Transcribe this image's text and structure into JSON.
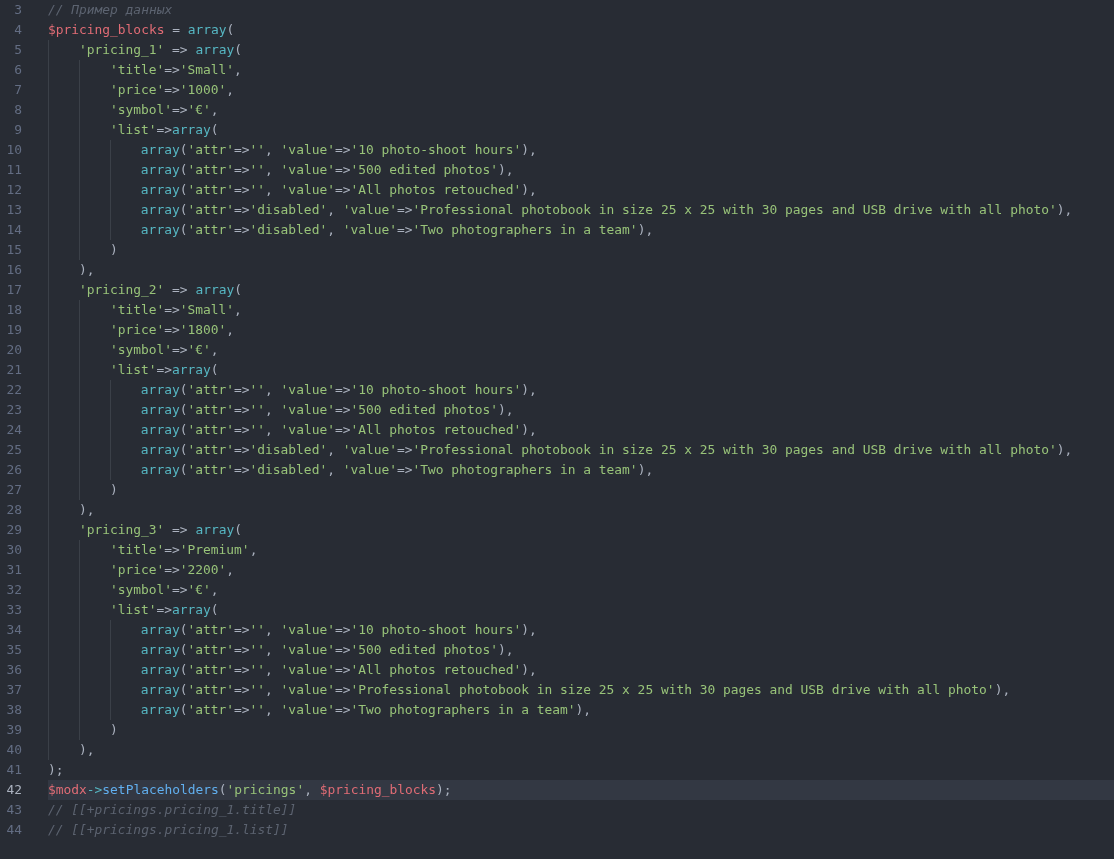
{
  "editor": {
    "lines": [
      {
        "number": "3",
        "current": false,
        "tokens": [
          {
            "kind": "comment",
            "text": "// Пример данных"
          }
        ]
      },
      {
        "number": "4",
        "current": false,
        "tokens": [
          {
            "kind": "variable",
            "text": "$pricing_blocks"
          },
          {
            "kind": "punct",
            "text": " = "
          },
          {
            "kind": "builtin",
            "text": "array"
          },
          {
            "kind": "punct",
            "text": "("
          }
        ],
        "children": [
          {
            "number": "5",
            "current": false,
            "tokens": [
              {
                "kind": "string",
                "text": "'pricing_1'"
              },
              {
                "kind": "punct",
                "text": " => "
              },
              {
                "kind": "builtin",
                "text": "array"
              },
              {
                "kind": "punct",
                "text": "("
              }
            ],
            "children": [
              {
                "number": "6",
                "current": false,
                "tokens": [
                  {
                    "kind": "string",
                    "text": "'title'"
                  },
                  {
                    "kind": "punct",
                    "text": "=>"
                  },
                  {
                    "kind": "string",
                    "text": "'Small'"
                  },
                  {
                    "kind": "punct",
                    "text": ","
                  }
                ]
              },
              {
                "number": "7",
                "current": false,
                "tokens": [
                  {
                    "kind": "string",
                    "text": "'price'"
                  },
                  {
                    "kind": "punct",
                    "text": "=>"
                  },
                  {
                    "kind": "string",
                    "text": "'1000'"
                  },
                  {
                    "kind": "punct",
                    "text": ","
                  }
                ]
              },
              {
                "number": "8",
                "current": false,
                "tokens": [
                  {
                    "kind": "string",
                    "text": "'symbol'"
                  },
                  {
                    "kind": "punct",
                    "text": "=>"
                  },
                  {
                    "kind": "string",
                    "text": "'€'"
                  },
                  {
                    "kind": "punct",
                    "text": ","
                  }
                ]
              },
              {
                "number": "9",
                "current": false,
                "tokens": [
                  {
                    "kind": "string",
                    "text": "'list'"
                  },
                  {
                    "kind": "punct",
                    "text": "=>"
                  },
                  {
                    "kind": "builtin",
                    "text": "array"
                  },
                  {
                    "kind": "punct",
                    "text": "("
                  }
                ],
                "children": [
                  {
                    "number": "10",
                    "current": false,
                    "tokens": [
                      {
                        "kind": "builtin",
                        "text": "array"
                      },
                      {
                        "kind": "punct",
                        "text": "("
                      },
                      {
                        "kind": "string",
                        "text": "'attr'"
                      },
                      {
                        "kind": "punct",
                        "text": "=>"
                      },
                      {
                        "kind": "string",
                        "text": "''"
                      },
                      {
                        "kind": "punct",
                        "text": ", "
                      },
                      {
                        "kind": "string",
                        "text": "'value'"
                      },
                      {
                        "kind": "punct",
                        "text": "=>"
                      },
                      {
                        "kind": "string",
                        "text": "'10 photo-shoot hours'"
                      },
                      {
                        "kind": "punct",
                        "text": "),"
                      }
                    ]
                  },
                  {
                    "number": "11",
                    "current": false,
                    "tokens": [
                      {
                        "kind": "builtin",
                        "text": "array"
                      },
                      {
                        "kind": "punct",
                        "text": "("
                      },
                      {
                        "kind": "string",
                        "text": "'attr'"
                      },
                      {
                        "kind": "punct",
                        "text": "=>"
                      },
                      {
                        "kind": "string",
                        "text": "''"
                      },
                      {
                        "kind": "punct",
                        "text": ", "
                      },
                      {
                        "kind": "string",
                        "text": "'value'"
                      },
                      {
                        "kind": "punct",
                        "text": "=>"
                      },
                      {
                        "kind": "string",
                        "text": "'500 edited photos'"
                      },
                      {
                        "kind": "punct",
                        "text": "),"
                      }
                    ]
                  },
                  {
                    "number": "12",
                    "current": false,
                    "tokens": [
                      {
                        "kind": "builtin",
                        "text": "array"
                      },
                      {
                        "kind": "punct",
                        "text": "("
                      },
                      {
                        "kind": "string",
                        "text": "'attr'"
                      },
                      {
                        "kind": "punct",
                        "text": "=>"
                      },
                      {
                        "kind": "string",
                        "text": "''"
                      },
                      {
                        "kind": "punct",
                        "text": ", "
                      },
                      {
                        "kind": "string",
                        "text": "'value'"
                      },
                      {
                        "kind": "punct",
                        "text": "=>"
                      },
                      {
                        "kind": "string",
                        "text": "'All photos retouched'"
                      },
                      {
                        "kind": "punct",
                        "text": "),"
                      }
                    ]
                  },
                  {
                    "number": "13",
                    "current": false,
                    "tokens": [
                      {
                        "kind": "builtin",
                        "text": "array"
                      },
                      {
                        "kind": "punct",
                        "text": "("
                      },
                      {
                        "kind": "string",
                        "text": "'attr'"
                      },
                      {
                        "kind": "punct",
                        "text": "=>"
                      },
                      {
                        "kind": "string",
                        "text": "'disabled'"
                      },
                      {
                        "kind": "punct",
                        "text": ", "
                      },
                      {
                        "kind": "string",
                        "text": "'value'"
                      },
                      {
                        "kind": "punct",
                        "text": "=>"
                      },
                      {
                        "kind": "string",
                        "text": "'Professional photobook in size 25 x 25 with 30 pages and USB drive with all photo'"
                      },
                      {
                        "kind": "punct",
                        "text": "),"
                      }
                    ]
                  },
                  {
                    "number": "14",
                    "current": false,
                    "tokens": [
                      {
                        "kind": "builtin",
                        "text": "array"
                      },
                      {
                        "kind": "punct",
                        "text": "("
                      },
                      {
                        "kind": "string",
                        "text": "'attr'"
                      },
                      {
                        "kind": "punct",
                        "text": "=>"
                      },
                      {
                        "kind": "string",
                        "text": "'disabled'"
                      },
                      {
                        "kind": "punct",
                        "text": ", "
                      },
                      {
                        "kind": "string",
                        "text": "'value'"
                      },
                      {
                        "kind": "punct",
                        "text": "=>"
                      },
                      {
                        "kind": "string",
                        "text": "'Two photographers in a team'"
                      },
                      {
                        "kind": "punct",
                        "text": "),"
                      }
                    ]
                  }
                ]
              },
              {
                "number": "15",
                "current": false,
                "tokens": [
                  {
                    "kind": "punct",
                    "text": ")"
                  }
                ]
              }
            ]
          },
          {
            "number": "16",
            "current": false,
            "tokens": [
              {
                "kind": "punct",
                "text": "),"
              }
            ]
          },
          {
            "number": "17",
            "current": false,
            "tokens": [
              {
                "kind": "string",
                "text": "'pricing_2'"
              },
              {
                "kind": "punct",
                "text": " => "
              },
              {
                "kind": "builtin",
                "text": "array"
              },
              {
                "kind": "punct",
                "text": "("
              }
            ],
            "children": [
              {
                "number": "18",
                "current": false,
                "tokens": [
                  {
                    "kind": "string",
                    "text": "'title'"
                  },
                  {
                    "kind": "punct",
                    "text": "=>"
                  },
                  {
                    "kind": "string",
                    "text": "'Small'"
                  },
                  {
                    "kind": "punct",
                    "text": ","
                  }
                ]
              },
              {
                "number": "19",
                "current": false,
                "tokens": [
                  {
                    "kind": "string",
                    "text": "'price'"
                  },
                  {
                    "kind": "punct",
                    "text": "=>"
                  },
                  {
                    "kind": "string",
                    "text": "'1800'"
                  },
                  {
                    "kind": "punct",
                    "text": ","
                  }
                ]
              },
              {
                "number": "20",
                "current": false,
                "tokens": [
                  {
                    "kind": "string",
                    "text": "'symbol'"
                  },
                  {
                    "kind": "punct",
                    "text": "=>"
                  },
                  {
                    "kind": "string",
                    "text": "'€'"
                  },
                  {
                    "kind": "punct",
                    "text": ","
                  }
                ]
              },
              {
                "number": "21",
                "current": false,
                "tokens": [
                  {
                    "kind": "string",
                    "text": "'list'"
                  },
                  {
                    "kind": "punct",
                    "text": "=>"
                  },
                  {
                    "kind": "builtin",
                    "text": "array"
                  },
                  {
                    "kind": "punct",
                    "text": "("
                  }
                ],
                "children": [
                  {
                    "number": "22",
                    "current": false,
                    "tokens": [
                      {
                        "kind": "builtin",
                        "text": "array"
                      },
                      {
                        "kind": "punct",
                        "text": "("
                      },
                      {
                        "kind": "string",
                        "text": "'attr'"
                      },
                      {
                        "kind": "punct",
                        "text": "=>"
                      },
                      {
                        "kind": "string",
                        "text": "''"
                      },
                      {
                        "kind": "punct",
                        "text": ", "
                      },
                      {
                        "kind": "string",
                        "text": "'value'"
                      },
                      {
                        "kind": "punct",
                        "text": "=>"
                      },
                      {
                        "kind": "string",
                        "text": "'10 photo-shoot hours'"
                      },
                      {
                        "kind": "punct",
                        "text": "),"
                      }
                    ]
                  },
                  {
                    "number": "23",
                    "current": false,
                    "tokens": [
                      {
                        "kind": "builtin",
                        "text": "array"
                      },
                      {
                        "kind": "punct",
                        "text": "("
                      },
                      {
                        "kind": "string",
                        "text": "'attr'"
                      },
                      {
                        "kind": "punct",
                        "text": "=>"
                      },
                      {
                        "kind": "string",
                        "text": "''"
                      },
                      {
                        "kind": "punct",
                        "text": ", "
                      },
                      {
                        "kind": "string",
                        "text": "'value'"
                      },
                      {
                        "kind": "punct",
                        "text": "=>"
                      },
                      {
                        "kind": "string",
                        "text": "'500 edited photos'"
                      },
                      {
                        "kind": "punct",
                        "text": "),"
                      }
                    ]
                  },
                  {
                    "number": "24",
                    "current": false,
                    "tokens": [
                      {
                        "kind": "builtin",
                        "text": "array"
                      },
                      {
                        "kind": "punct",
                        "text": "("
                      },
                      {
                        "kind": "string",
                        "text": "'attr'"
                      },
                      {
                        "kind": "punct",
                        "text": "=>"
                      },
                      {
                        "kind": "string",
                        "text": "''"
                      },
                      {
                        "kind": "punct",
                        "text": ", "
                      },
                      {
                        "kind": "string",
                        "text": "'value'"
                      },
                      {
                        "kind": "punct",
                        "text": "=>"
                      },
                      {
                        "kind": "string",
                        "text": "'All photos retouched'"
                      },
                      {
                        "kind": "punct",
                        "text": "),"
                      }
                    ]
                  },
                  {
                    "number": "25",
                    "current": false,
                    "tokens": [
                      {
                        "kind": "builtin",
                        "text": "array"
                      },
                      {
                        "kind": "punct",
                        "text": "("
                      },
                      {
                        "kind": "string",
                        "text": "'attr'"
                      },
                      {
                        "kind": "punct",
                        "text": "=>"
                      },
                      {
                        "kind": "string",
                        "text": "'disabled'"
                      },
                      {
                        "kind": "punct",
                        "text": ", "
                      },
                      {
                        "kind": "string",
                        "text": "'value'"
                      },
                      {
                        "kind": "punct",
                        "text": "=>"
                      },
                      {
                        "kind": "string",
                        "text": "'Professional photobook in size 25 x 25 with 30 pages and USB drive with all photo'"
                      },
                      {
                        "kind": "punct",
                        "text": "),"
                      }
                    ]
                  },
                  {
                    "number": "26",
                    "current": false,
                    "tokens": [
                      {
                        "kind": "builtin",
                        "text": "array"
                      },
                      {
                        "kind": "punct",
                        "text": "("
                      },
                      {
                        "kind": "string",
                        "text": "'attr'"
                      },
                      {
                        "kind": "punct",
                        "text": "=>"
                      },
                      {
                        "kind": "string",
                        "text": "'disabled'"
                      },
                      {
                        "kind": "punct",
                        "text": ", "
                      },
                      {
                        "kind": "string",
                        "text": "'value'"
                      },
                      {
                        "kind": "punct",
                        "text": "=>"
                      },
                      {
                        "kind": "string",
                        "text": "'Two photographers in a team'"
                      },
                      {
                        "kind": "punct",
                        "text": "),"
                      }
                    ]
                  }
                ]
              },
              {
                "number": "27",
                "current": false,
                "tokens": [
                  {
                    "kind": "punct",
                    "text": ")"
                  }
                ]
              }
            ]
          },
          {
            "number": "28",
            "current": false,
            "tokens": [
              {
                "kind": "punct",
                "text": "),"
              }
            ]
          },
          {
            "number": "29",
            "current": false,
            "tokens": [
              {
                "kind": "string",
                "text": "'pricing_3'"
              },
              {
                "kind": "punct",
                "text": " => "
              },
              {
                "kind": "builtin",
                "text": "array"
              },
              {
                "kind": "punct",
                "text": "("
              }
            ],
            "children": [
              {
                "number": "30",
                "current": false,
                "tokens": [
                  {
                    "kind": "string",
                    "text": "'title'"
                  },
                  {
                    "kind": "punct",
                    "text": "=>"
                  },
                  {
                    "kind": "string",
                    "text": "'Premium'"
                  },
                  {
                    "kind": "punct",
                    "text": ","
                  }
                ]
              },
              {
                "number": "31",
                "current": false,
                "tokens": [
                  {
                    "kind": "string",
                    "text": "'price'"
                  },
                  {
                    "kind": "punct",
                    "text": "=>"
                  },
                  {
                    "kind": "string",
                    "text": "'2200'"
                  },
                  {
                    "kind": "punct",
                    "text": ","
                  }
                ]
              },
              {
                "number": "32",
                "current": false,
                "tokens": [
                  {
                    "kind": "string",
                    "text": "'symbol'"
                  },
                  {
                    "kind": "punct",
                    "text": "=>"
                  },
                  {
                    "kind": "string",
                    "text": "'€'"
                  },
                  {
                    "kind": "punct",
                    "text": ","
                  }
                ]
              },
              {
                "number": "33",
                "current": false,
                "tokens": [
                  {
                    "kind": "string",
                    "text": "'list'"
                  },
                  {
                    "kind": "punct",
                    "text": "=>"
                  },
                  {
                    "kind": "builtin",
                    "text": "array"
                  },
                  {
                    "kind": "punct",
                    "text": "("
                  }
                ],
                "children": [
                  {
                    "number": "34",
                    "current": false,
                    "tokens": [
                      {
                        "kind": "builtin",
                        "text": "array"
                      },
                      {
                        "kind": "punct",
                        "text": "("
                      },
                      {
                        "kind": "string",
                        "text": "'attr'"
                      },
                      {
                        "kind": "punct",
                        "text": "=>"
                      },
                      {
                        "kind": "string",
                        "text": "''"
                      },
                      {
                        "kind": "punct",
                        "text": ", "
                      },
                      {
                        "kind": "string",
                        "text": "'value'"
                      },
                      {
                        "kind": "punct",
                        "text": "=>"
                      },
                      {
                        "kind": "string",
                        "text": "'10 photo-shoot hours'"
                      },
                      {
                        "kind": "punct",
                        "text": "),"
                      }
                    ]
                  },
                  {
                    "number": "35",
                    "current": false,
                    "tokens": [
                      {
                        "kind": "builtin",
                        "text": "array"
                      },
                      {
                        "kind": "punct",
                        "text": "("
                      },
                      {
                        "kind": "string",
                        "text": "'attr'"
                      },
                      {
                        "kind": "punct",
                        "text": "=>"
                      },
                      {
                        "kind": "string",
                        "text": "''"
                      },
                      {
                        "kind": "punct",
                        "text": ", "
                      },
                      {
                        "kind": "string",
                        "text": "'value'"
                      },
                      {
                        "kind": "punct",
                        "text": "=>"
                      },
                      {
                        "kind": "string",
                        "text": "'500 edited photos'"
                      },
                      {
                        "kind": "punct",
                        "text": "),"
                      }
                    ]
                  },
                  {
                    "number": "36",
                    "current": false,
                    "tokens": [
                      {
                        "kind": "builtin",
                        "text": "array"
                      },
                      {
                        "kind": "punct",
                        "text": "("
                      },
                      {
                        "kind": "string",
                        "text": "'attr'"
                      },
                      {
                        "kind": "punct",
                        "text": "=>"
                      },
                      {
                        "kind": "string",
                        "text": "''"
                      },
                      {
                        "kind": "punct",
                        "text": ", "
                      },
                      {
                        "kind": "string",
                        "text": "'value'"
                      },
                      {
                        "kind": "punct",
                        "text": "=>"
                      },
                      {
                        "kind": "string",
                        "text": "'All photos retouched'"
                      },
                      {
                        "kind": "punct",
                        "text": "),"
                      }
                    ]
                  },
                  {
                    "number": "37",
                    "current": false,
                    "tokens": [
                      {
                        "kind": "builtin",
                        "text": "array"
                      },
                      {
                        "kind": "punct",
                        "text": "("
                      },
                      {
                        "kind": "string",
                        "text": "'attr'"
                      },
                      {
                        "kind": "punct",
                        "text": "=>"
                      },
                      {
                        "kind": "string",
                        "text": "''"
                      },
                      {
                        "kind": "punct",
                        "text": ", "
                      },
                      {
                        "kind": "string",
                        "text": "'value'"
                      },
                      {
                        "kind": "punct",
                        "text": "=>"
                      },
                      {
                        "kind": "string",
                        "text": "'Professional photobook in size 25 x 25 with 30 pages and USB drive with all photo'"
                      },
                      {
                        "kind": "punct",
                        "text": "),"
                      }
                    ]
                  },
                  {
                    "number": "38",
                    "current": false,
                    "tokens": [
                      {
                        "kind": "builtin",
                        "text": "array"
                      },
                      {
                        "kind": "punct",
                        "text": "("
                      },
                      {
                        "kind": "string",
                        "text": "'attr'"
                      },
                      {
                        "kind": "punct",
                        "text": "=>"
                      },
                      {
                        "kind": "string",
                        "text": "''"
                      },
                      {
                        "kind": "punct",
                        "text": ", "
                      },
                      {
                        "kind": "string",
                        "text": "'value'"
                      },
                      {
                        "kind": "punct",
                        "text": "=>"
                      },
                      {
                        "kind": "string",
                        "text": "'Two photographers in a team'"
                      },
                      {
                        "kind": "punct",
                        "text": "),"
                      }
                    ]
                  }
                ]
              },
              {
                "number": "39",
                "current": false,
                "tokens": [
                  {
                    "kind": "punct",
                    "text": ")"
                  }
                ]
              }
            ]
          },
          {
            "number": "40",
            "current": false,
            "tokens": [
              {
                "kind": "punct",
                "text": "),"
              }
            ]
          }
        ]
      },
      {
        "number": "41",
        "current": false,
        "tokens": [
          {
            "kind": "punct",
            "text": ");"
          }
        ]
      },
      {
        "number": "42",
        "current": true,
        "tokens": [
          {
            "kind": "variable",
            "text": "$modx"
          },
          {
            "kind": "operator",
            "text": "->"
          },
          {
            "kind": "method",
            "text": "setPlaceholders"
          },
          {
            "kind": "punct",
            "text": "("
          },
          {
            "kind": "string",
            "text": "'pricings'"
          },
          {
            "kind": "punct",
            "text": ", "
          },
          {
            "kind": "variable",
            "text": "$pricing_blocks"
          },
          {
            "kind": "punct",
            "text": ");"
          }
        ]
      },
      {
        "number": "43",
        "current": false,
        "tokens": [
          {
            "kind": "comment",
            "text": "// [[+pricings.pricing_1.title]]"
          }
        ]
      },
      {
        "number": "44",
        "current": false,
        "tokens": [
          {
            "kind": "comment",
            "text": "// [[+pricings.pricing_1.list]]"
          }
        ]
      }
    ]
  }
}
